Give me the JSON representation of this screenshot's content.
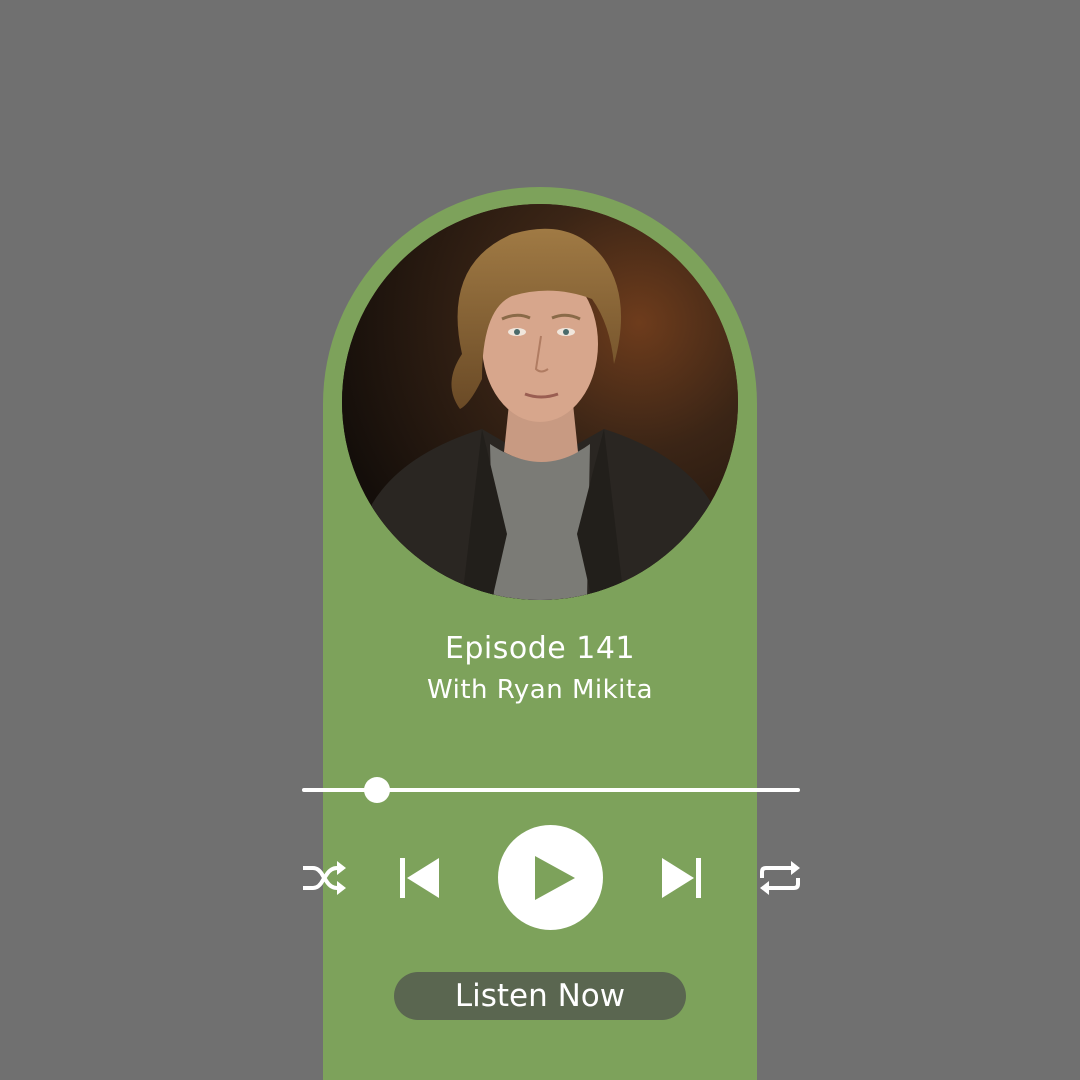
{
  "colors": {
    "background": "#707070",
    "card": "#7da25b",
    "accent": "#ffffff",
    "button": "#5a6650"
  },
  "episode": {
    "title": "Episode 141",
    "guest": "With Ryan Mikita"
  },
  "player": {
    "progress_fraction": 0.15,
    "icons": {
      "shuffle": "shuffle-icon",
      "previous": "skip-previous-icon",
      "play": "play-icon",
      "next": "skip-next-icon",
      "repeat": "repeat-icon"
    }
  },
  "cta": {
    "label": "Listen Now"
  }
}
